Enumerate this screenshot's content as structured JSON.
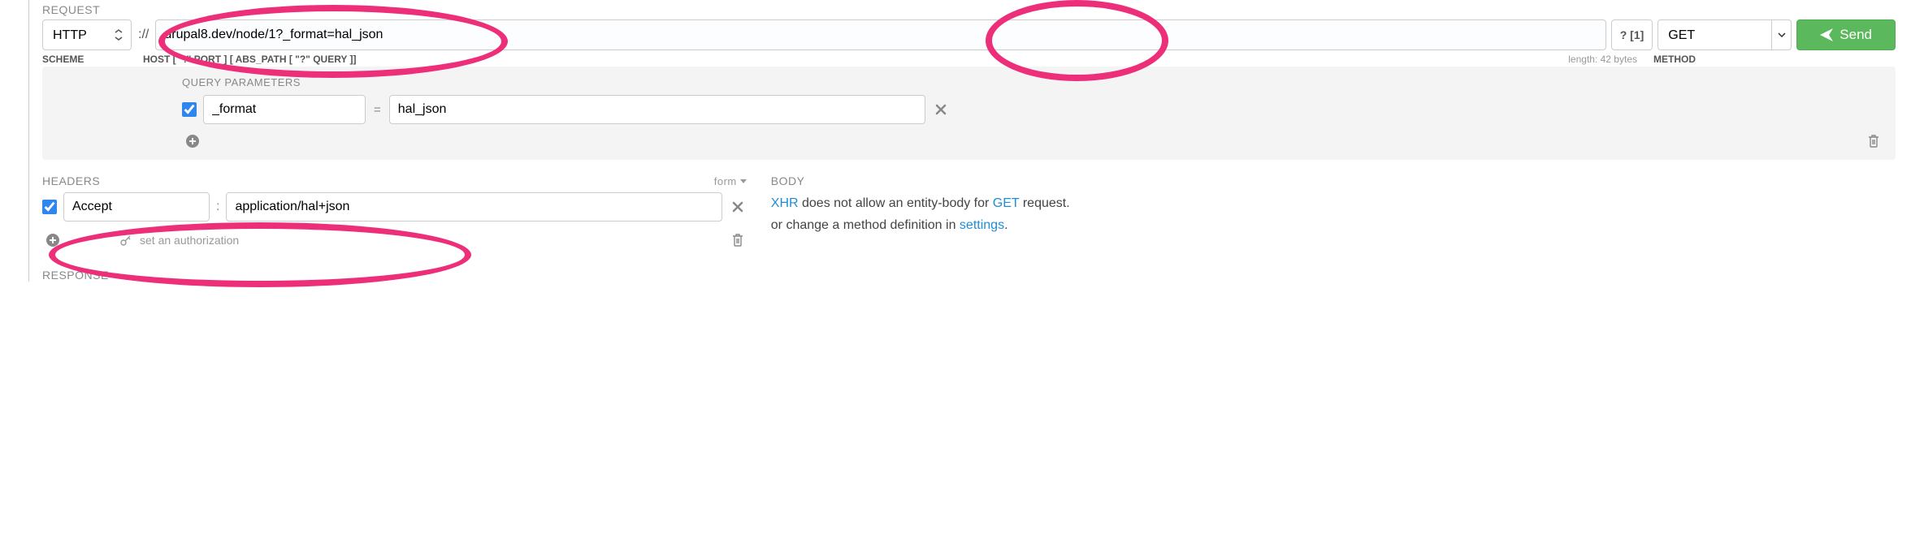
{
  "request": {
    "title": "REQUEST",
    "scheme": "HTTP",
    "scheme_sep": "://",
    "url": "drupal8.dev/node/1?_format=hal_json",
    "hint_btn": "? [1]",
    "method": "GET",
    "send_label": "Send",
    "labels": {
      "scheme": "SCHEME",
      "host": "HOST [ \":\" PORT ] [ ABS_PATH [ \"?\" QUERY ]]",
      "length": "length: 42 bytes",
      "method": "METHOD"
    }
  },
  "query_params": {
    "title": "QUERY PARAMETERS",
    "rows": [
      {
        "enabled": true,
        "key": "_format",
        "value": "hal_json"
      }
    ]
  },
  "headers": {
    "title": "HEADERS",
    "form_mode": "form",
    "rows": [
      {
        "enabled": true,
        "key": "Accept",
        "value": "application/hal+json"
      }
    ],
    "auth_link": "set an authorization"
  },
  "body": {
    "title": "BODY",
    "line1_a": "XHR",
    "line1_b": " does not allow an entity-body for ",
    "line1_c": "GET",
    "line1_d": " request.",
    "line2_a": "or change a method definition in ",
    "line2_b": "settings",
    "line2_c": "."
  },
  "response": {
    "title": "RESPONSE"
  }
}
